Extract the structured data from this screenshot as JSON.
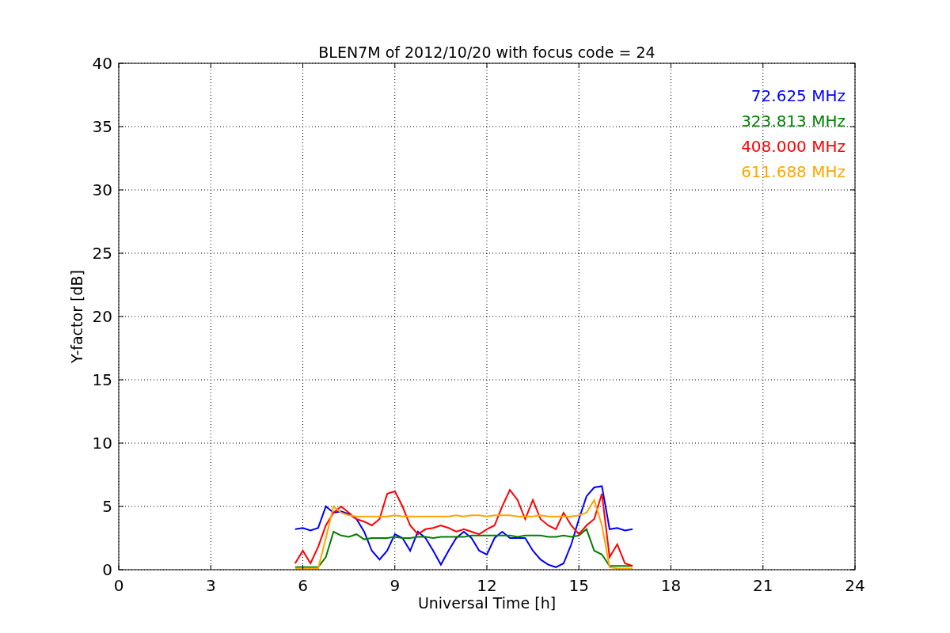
{
  "chart_data": {
    "type": "line",
    "title": "BLEN7M of 2012/10/20 with focus code = 24",
    "xlabel": "Universal Time [h]",
    "ylabel": "Y-factor [dB]",
    "x": [
      5.75,
      6.0,
      6.25,
      6.5,
      6.75,
      7.0,
      7.25,
      7.5,
      7.75,
      8.0,
      8.25,
      8.5,
      8.75,
      9.0,
      9.25,
      9.5,
      9.75,
      10.0,
      10.25,
      10.5,
      10.75,
      11.0,
      11.25,
      11.5,
      11.75,
      12.0,
      12.25,
      12.5,
      12.75,
      13.0,
      13.25,
      13.5,
      13.75,
      14.0,
      14.25,
      14.5,
      14.75,
      15.0,
      15.25,
      15.5,
      15.75,
      16.0,
      16.25,
      16.5,
      16.75
    ],
    "series": [
      {
        "name": "72.625 MHz",
        "color": "#0000ff",
        "values": [
          3.2,
          3.3,
          3.1,
          3.3,
          5.0,
          4.5,
          4.6,
          4.4,
          4.0,
          3.0,
          1.5,
          0.8,
          1.5,
          2.8,
          2.5,
          1.5,
          3.0,
          2.5,
          1.5,
          0.4,
          1.5,
          2.5,
          3.0,
          2.5,
          1.5,
          1.2,
          2.5,
          3.0,
          2.5,
          2.5,
          2.5,
          1.5,
          0.8,
          0.4,
          0.2,
          0.5,
          2.0,
          4.0,
          5.8,
          6.5,
          6.6,
          3.2,
          3.3,
          3.1,
          3.2
        ]
      },
      {
        "name": "323.813 MHz",
        "color": "#008000",
        "values": [
          0.2,
          0.2,
          0.2,
          0.2,
          1.0,
          3.0,
          2.7,
          2.6,
          2.8,
          2.4,
          2.5,
          2.5,
          2.5,
          2.6,
          2.5,
          2.5,
          2.6,
          2.6,
          2.5,
          2.6,
          2.6,
          2.6,
          2.6,
          2.7,
          2.7,
          2.7,
          2.7,
          2.7,
          2.7,
          2.6,
          2.7,
          2.7,
          2.7,
          2.6,
          2.6,
          2.7,
          2.6,
          2.7,
          3.2,
          1.5,
          1.2,
          0.3,
          0.3,
          0.3,
          0.3
        ]
      },
      {
        "name": "408.000 MHz",
        "color": "#ff0000",
        "values": [
          0.5,
          1.5,
          0.5,
          1.8,
          3.5,
          4.5,
          5.0,
          4.5,
          4.0,
          3.8,
          3.5,
          4.0,
          6.0,
          6.2,
          5.0,
          3.5,
          2.8,
          3.2,
          3.3,
          3.5,
          3.3,
          3.0,
          3.2,
          3.0,
          2.8,
          3.2,
          3.5,
          5.0,
          6.3,
          5.5,
          4.0,
          5.5,
          4.0,
          3.5,
          3.2,
          4.5,
          3.5,
          2.8,
          3.5,
          4.0,
          6.0,
          1.0,
          2.0,
          0.5,
          0.3
        ]
      },
      {
        "name": "611.688 MHz",
        "color": "#ffa500",
        "values": [
          0.1,
          0.1,
          0.1,
          0.1,
          2.5,
          5.0,
          4.5,
          4.3,
          4.2,
          4.2,
          4.2,
          4.2,
          4.2,
          4.3,
          4.2,
          4.2,
          4.2,
          4.2,
          4.2,
          4.2,
          4.2,
          4.3,
          4.2,
          4.3,
          4.3,
          4.2,
          4.3,
          4.3,
          4.3,
          4.2,
          4.2,
          4.2,
          4.3,
          4.2,
          4.2,
          4.2,
          4.2,
          4.3,
          4.5,
          5.5,
          3.5,
          0.2,
          0.1,
          0.1,
          0.1
        ]
      }
    ],
    "grid": true,
    "xlim": [
      0,
      24
    ],
    "ylim": [
      0,
      40
    ],
    "xticks": [
      0,
      3,
      6,
      9,
      12,
      15,
      18,
      21,
      24
    ],
    "yticks": [
      0,
      5,
      10,
      15,
      20,
      25,
      30,
      35,
      40
    ]
  }
}
